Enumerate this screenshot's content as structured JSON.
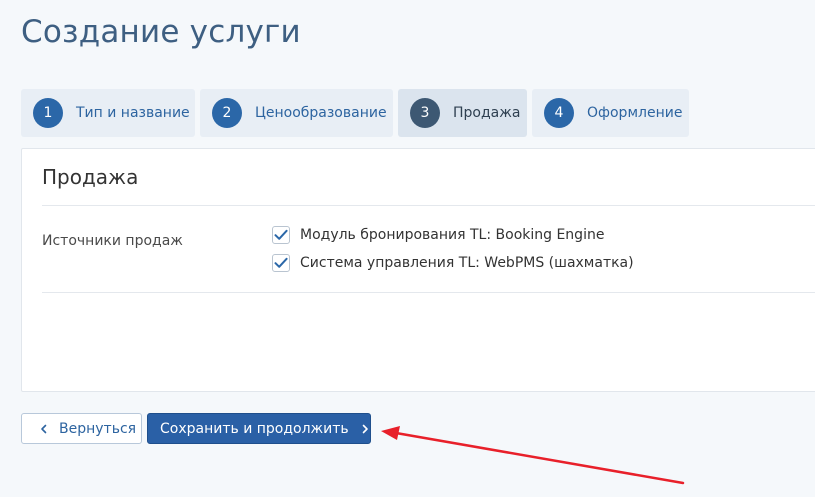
{
  "page": {
    "title": "Создание услуги"
  },
  "steps": [
    {
      "number": "1",
      "label": "Тип и название",
      "active": false
    },
    {
      "number": "2",
      "label": "Ценообразование",
      "active": false
    },
    {
      "number": "3",
      "label": "Продажа",
      "active": true
    },
    {
      "number": "4",
      "label": "Оформление",
      "active": false
    }
  ],
  "section": {
    "title": "Продажа",
    "field_label": "Источники продаж",
    "options": [
      {
        "label": "Модуль бронирования TL: Booking Engine",
        "checked": true
      },
      {
        "label": "Система управления TL: WebPMS (шахматка)",
        "checked": true
      }
    ]
  },
  "actions": {
    "back_label": "Вернуться",
    "save_label": "Сохранить и продолжить",
    "back_icon": "chevron-left-icon",
    "save_icon": "chevron-right-icon"
  },
  "colors": {
    "title": "#3e5f82",
    "step_badge": "#2b67a8",
    "step_badge_active": "#3d5873",
    "primary_button": "#2a60a6",
    "annotation_arrow": "#e8202a"
  }
}
